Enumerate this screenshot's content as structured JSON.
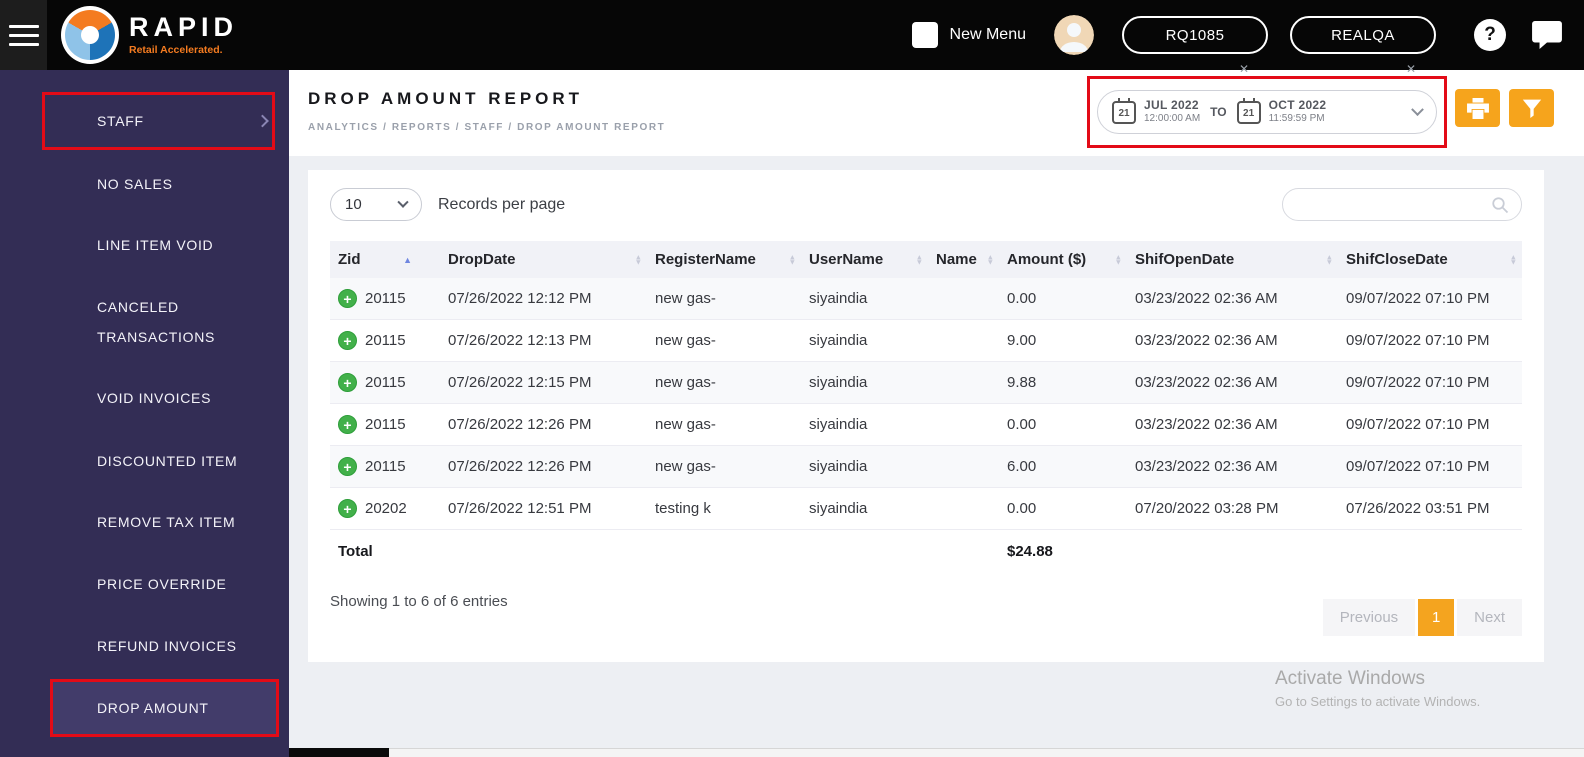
{
  "topbar": {
    "brand_name": "RAPID",
    "brand_tagline": "Retail Accelerated.",
    "new_menu_label": "New Menu",
    "register_code": "RQ1085",
    "store_code": "REALQA",
    "help_glyph": "?"
  },
  "sidebar": {
    "items": [
      {
        "label": "STAFF"
      },
      {
        "label": "NO SALES"
      },
      {
        "label": "LINE ITEM VOID"
      },
      {
        "label": "CANCELED TRANSACTIONS"
      },
      {
        "label": "VOID INVOICES"
      },
      {
        "label": "DISCOUNTED ITEM"
      },
      {
        "label": "REMOVE TAX ITEM"
      },
      {
        "label": "PRICE OVERRIDE"
      },
      {
        "label": "REFUND INVOICES"
      },
      {
        "label": "DROP AMOUNT"
      }
    ]
  },
  "header": {
    "title": "DROP AMOUNT REPORT",
    "breadcrumb": "ANALYTICS / REPORTS / STAFF / DROP AMOUNT REPORT"
  },
  "date_range": {
    "from_day": "21",
    "from_month": "JUL 2022",
    "from_time": "12:00:00 AM",
    "to_label": "TO",
    "to_day": "21",
    "to_month": "OCT 2022",
    "to_time": "11:59:59 PM"
  },
  "controls": {
    "records_per_page": "10",
    "records_label": "Records per page"
  },
  "table": {
    "columns": [
      "Zid",
      "DropDate",
      "RegisterName",
      "UserName",
      "Name",
      "Amount ($)",
      "ShifOpenDate",
      "ShifCloseDate"
    ],
    "rows": [
      [
        "20115",
        "07/26/2022 12:12 PM",
        "new gas-",
        "siyaindia",
        "",
        "0.00",
        "03/23/2022 02:36 AM",
        "09/07/2022 07:10 PM"
      ],
      [
        "20115",
        "07/26/2022 12:13 PM",
        "new gas-",
        "siyaindia",
        "",
        "9.00",
        "03/23/2022 02:36 AM",
        "09/07/2022 07:10 PM"
      ],
      [
        "20115",
        "07/26/2022 12:15 PM",
        "new gas-",
        "siyaindia",
        "",
        "9.88",
        "03/23/2022 02:36 AM",
        "09/07/2022 07:10 PM"
      ],
      [
        "20115",
        "07/26/2022 12:26 PM",
        "new gas-",
        "siyaindia",
        "",
        "0.00",
        "03/23/2022 02:36 AM",
        "09/07/2022 07:10 PM"
      ],
      [
        "20115",
        "07/26/2022 12:26 PM",
        "new gas-",
        "siyaindia",
        "",
        "6.00",
        "03/23/2022 02:36 AM",
        "09/07/2022 07:10 PM"
      ],
      [
        "20202",
        "07/26/2022 12:51 PM",
        "testing k",
        "siyaindia",
        "",
        "0.00",
        "07/20/2022 03:28 PM",
        "07/26/2022 03:51 PM"
      ]
    ],
    "total_label": "Total",
    "total_amount": "$24.88"
  },
  "footer": {
    "showing_text": "Showing 1 to 6 of 6 entries",
    "prev_label": "Previous",
    "page_number": "1",
    "next_label": "Next"
  },
  "watermark": {
    "line1": "Activate Windows",
    "line2": "Go to Settings to activate Windows."
  },
  "colors": {
    "accent_orange": "#F6A41C",
    "highlight_red": "#E30B17",
    "sidebar_purple": "#332D55",
    "green_plus": "#42B04A",
    "topbar_black": "#060606"
  }
}
